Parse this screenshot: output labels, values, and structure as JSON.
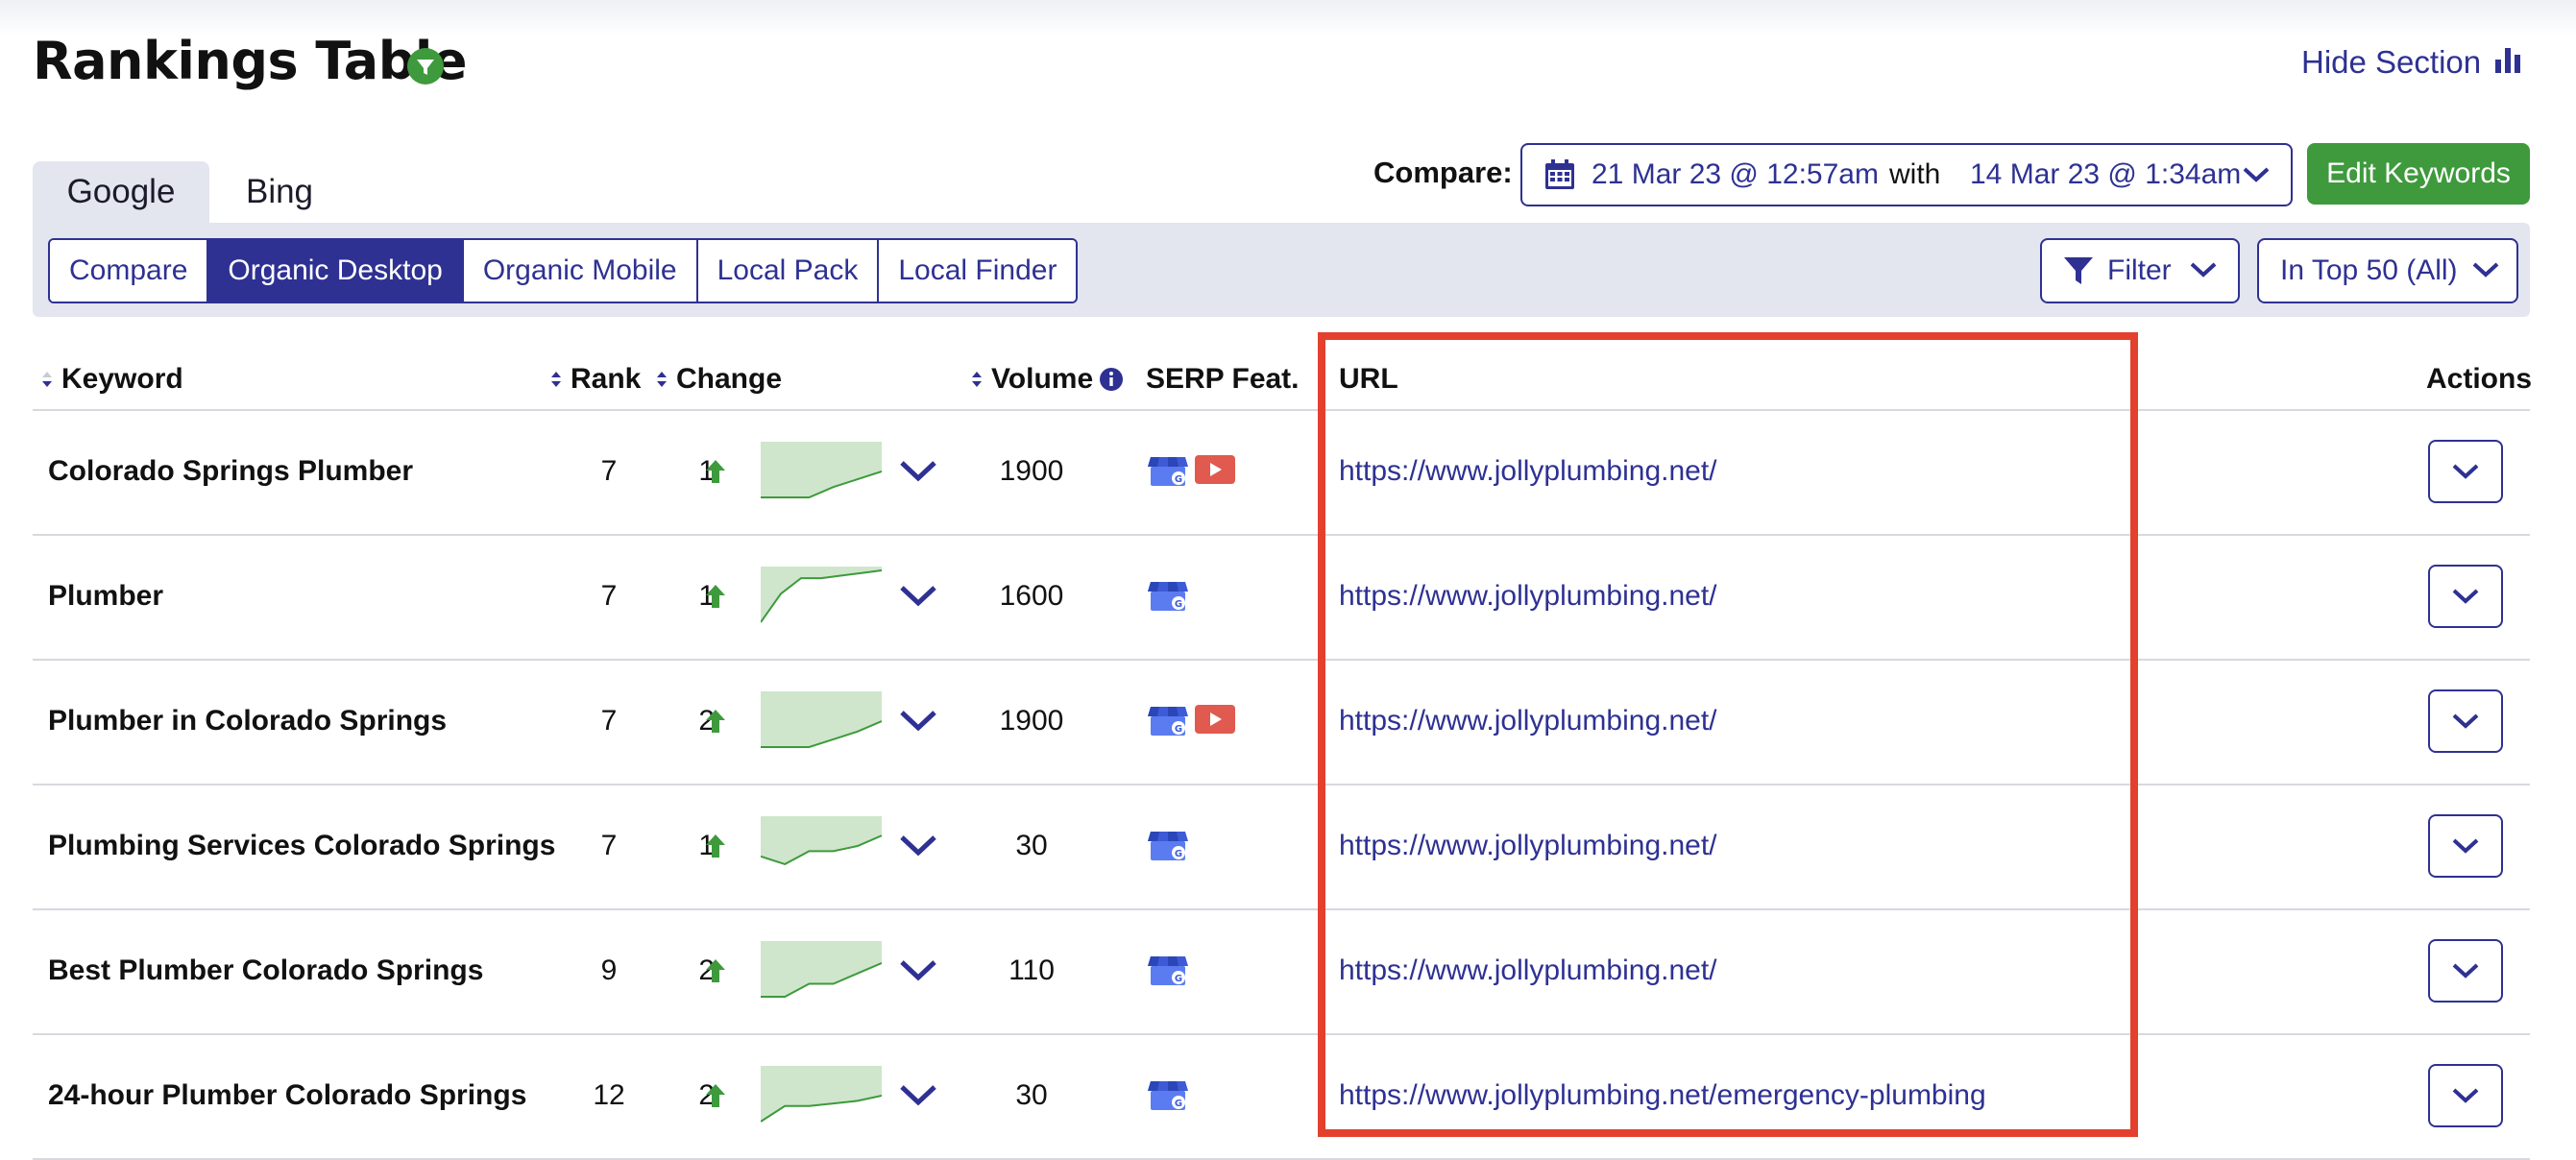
{
  "header": {
    "title": "Rankings Table",
    "hide_section_label": "Hide Section"
  },
  "engine_tabs": [
    {
      "label": "Google",
      "active": true
    },
    {
      "label": "Bing",
      "active": false
    }
  ],
  "view_segments": [
    {
      "label": "Compare",
      "active": false
    },
    {
      "label": "Organic Desktop",
      "active": true
    },
    {
      "label": "Organic Mobile",
      "active": false
    },
    {
      "label": "Local Pack",
      "active": false
    },
    {
      "label": "Local Finder",
      "active": false
    }
  ],
  "compare": {
    "label": "Compare:",
    "date_from": "21 Mar 23 @ 12:57am",
    "with_label": "with",
    "date_to": "14 Mar 23 @ 1:34am"
  },
  "edit_keywords_label": "Edit Keywords",
  "filter_label": "Filter",
  "top_filter_label": "In Top 50 (All)",
  "columns": {
    "keyword": "Keyword",
    "rank": "Rank",
    "change": "Change",
    "volume": "Volume",
    "serp": "SERP Feat.",
    "url": "URL",
    "actions": "Actions"
  },
  "rows": [
    {
      "keyword": "Colorado Springs Plumber",
      "rank": "7",
      "change": "1",
      "volume": "1900",
      "serp": [
        "google-business-icon",
        "youtube-icon"
      ],
      "url": "https://www.jollyplumbing.net/",
      "trend": [
        0,
        0,
        0,
        0.2,
        0.35,
        0.5
      ]
    },
    {
      "keyword": "Plumber",
      "rank": "7",
      "change": "1",
      "volume": "1600",
      "serp": [
        "google-business-icon"
      ],
      "url": "https://www.jollyplumbing.net/",
      "trend": [
        0,
        0.55,
        0.85,
        0.85,
        0.9,
        0.95,
        1
      ]
    },
    {
      "keyword": "Plumber in Colorado Springs",
      "rank": "7",
      "change": "2",
      "volume": "1900",
      "serp": [
        "google-business-icon",
        "youtube-icon"
      ],
      "url": "https://www.jollyplumbing.net/",
      "trend": [
        0,
        0,
        0,
        0.15,
        0.3,
        0.5
      ]
    },
    {
      "keyword": "Plumbing Services Colorado Springs",
      "rank": "7",
      "change": "1",
      "volume": "30",
      "serp": [
        "google-business-icon"
      ],
      "url": "https://www.jollyplumbing.net/",
      "trend": [
        0.3,
        0.15,
        0.4,
        0.4,
        0.5,
        0.7
      ]
    },
    {
      "keyword": "Best Plumber Colorado Springs",
      "rank": "9",
      "change": "2",
      "volume": "110",
      "serp": [
        "google-business-icon"
      ],
      "url": "https://www.jollyplumbing.net/",
      "trend": [
        0,
        0,
        0.25,
        0.25,
        0.45,
        0.65
      ]
    },
    {
      "keyword": "24-hour Plumber Colorado Springs",
      "rank": "12",
      "change": "2",
      "volume": "30",
      "serp": [
        "google-business-icon"
      ],
      "url": "https://www.jollyplumbing.net/emergency-plumbing",
      "trend": [
        0,
        0.3,
        0.3,
        0.35,
        0.4,
        0.5
      ]
    }
  ],
  "colors": {
    "brand_navy": "#2e3192",
    "accent_green": "#3e9a3c",
    "highlight_red": "#e3412e",
    "panel_bg": "#e3e6ef"
  }
}
